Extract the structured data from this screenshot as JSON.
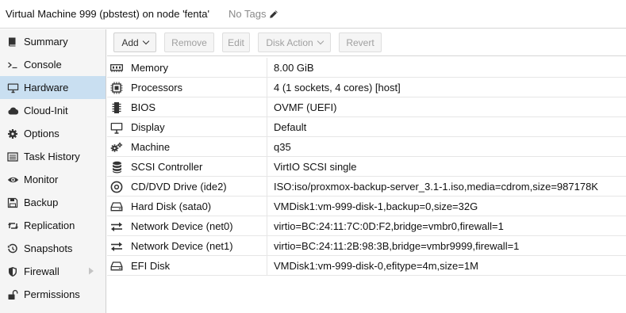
{
  "header": {
    "title": "Virtual Machine 999 (pbstest) on node 'fenta'",
    "tags": "No Tags",
    "tags_icon": "pencil-icon"
  },
  "sidebar": {
    "items": [
      {
        "label": "Summary",
        "icon": "book-icon"
      },
      {
        "label": "Console",
        "icon": "terminal-icon"
      },
      {
        "label": "Hardware",
        "icon": "monitor-icon",
        "active": true
      },
      {
        "label": "Cloud-Init",
        "icon": "cloud-icon"
      },
      {
        "label": "Options",
        "icon": "gear-icon"
      },
      {
        "label": "Task History",
        "icon": "list-icon"
      },
      {
        "label": "Monitor",
        "icon": "eye-icon"
      },
      {
        "label": "Backup",
        "icon": "floppy-icon"
      },
      {
        "label": "Replication",
        "icon": "retweet-icon"
      },
      {
        "label": "Snapshots",
        "icon": "history-icon"
      },
      {
        "label": "Firewall",
        "icon": "shield-icon",
        "expandable": true
      },
      {
        "label": "Permissions",
        "icon": "unlock-icon"
      }
    ]
  },
  "toolbar": {
    "add": "Add",
    "remove": "Remove",
    "edit": "Edit",
    "disk_action": "Disk Action",
    "revert": "Revert"
  },
  "hardware": [
    {
      "name": "Memory",
      "value": "8.00 GiB",
      "icon": "memory-icon"
    },
    {
      "name": "Processors",
      "value": "4 (1 sockets, 4 cores) [host]",
      "icon": "cpu-icon"
    },
    {
      "name": "BIOS",
      "value": "OVMF (UEFI)",
      "icon": "microchip-icon"
    },
    {
      "name": "Display",
      "value": "Default",
      "icon": "desktop-icon"
    },
    {
      "name": "Machine",
      "value": "q35",
      "icon": "cogs-icon"
    },
    {
      "name": "SCSI Controller",
      "value": "VirtIO SCSI single",
      "icon": "database-icon"
    },
    {
      "name": "CD/DVD Drive (ide2)",
      "value": "ISO:iso/proxmox-backup-server_3.1-1.iso,media=cdrom,size=987178K",
      "icon": "cdrom-icon"
    },
    {
      "name": "Hard Disk (sata0)",
      "value": "VMDisk1:vm-999-disk-1,backup=0,size=32G",
      "icon": "hdd-icon"
    },
    {
      "name": "Network Device (net0)",
      "value": "virtio=BC:24:11:7C:0D:F2,bridge=vmbr0,firewall=1",
      "icon": "exchange-icon"
    },
    {
      "name": "Network Device (net1)",
      "value": "virtio=BC:24:11:2B:98:3B,bridge=vmbr9999,firewall=1",
      "icon": "exchange-icon"
    },
    {
      "name": "EFI Disk",
      "value": "VMDisk1:vm-999-disk-0,efitype=4m,size=1M",
      "icon": "hdd-icon"
    }
  ],
  "colors": {
    "active_nav": "#c9dff1",
    "sidebar_bg": "#f5f5f5",
    "border": "#d6d6d6"
  }
}
